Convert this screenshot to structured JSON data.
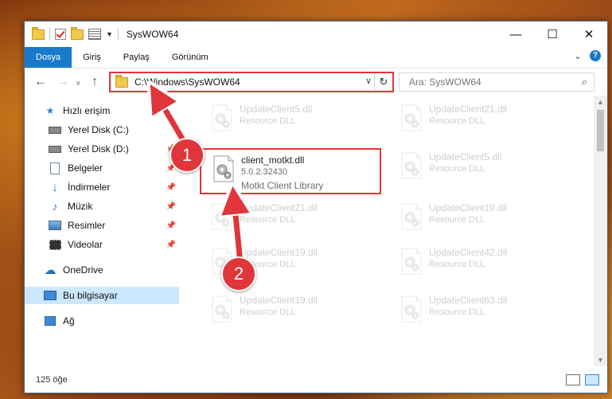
{
  "window": {
    "title": "SysWOW64",
    "controls": {
      "minimize": "—",
      "maximize": "☐",
      "close": "✕"
    }
  },
  "ribbon": {
    "tabs": [
      "Dosya",
      "Giriş",
      "Paylaş",
      "Görünüm"
    ],
    "active_tab": "Dosya",
    "expand_glyph": "⌄",
    "help_glyph": "?"
  },
  "address": {
    "path": "C:\\Windows\\SysWOW64",
    "search_placeholder": "Ara: SysWOW64"
  },
  "sidebar": {
    "items": [
      {
        "label": "Hızlı erişim",
        "icon": "star-icon",
        "pinned": false
      },
      {
        "label": "Yerel Disk (C:)",
        "icon": "drive-icon",
        "pinned": false
      },
      {
        "label": "Yerel Disk (D:)",
        "icon": "drive-icon",
        "pinned": true
      },
      {
        "label": "Belgeler",
        "icon": "document-icon",
        "pinned": true
      },
      {
        "label": "İndirmeler",
        "icon": "download-icon",
        "pinned": true
      },
      {
        "label": "Müzik",
        "icon": "music-icon",
        "pinned": true
      },
      {
        "label": "Resimler",
        "icon": "pictures-icon",
        "pinned": true
      },
      {
        "label": "Videolar",
        "icon": "video-icon",
        "pinned": true
      },
      {
        "label": "OneDrive",
        "icon": "cloud-icon",
        "pinned": false
      },
      {
        "label": "Bu bilgisayar",
        "icon": "computer-icon",
        "pinned": false,
        "selected": true
      },
      {
        "label": "Ağ",
        "icon": "network-icon",
        "pinned": false
      }
    ]
  },
  "files": {
    "focused": {
      "name": "client_motkt.dll",
      "version": "5.0.2.32430",
      "description": "Motkt Client Library"
    },
    "background": [
      {
        "name": "UpdateClient5.dll",
        "type": "Resource DLL"
      },
      {
        "name": "UpdateClient21.dll",
        "type": "Resource DLL"
      },
      {
        "name": "UpdateClient5.dll",
        "type": "Resource DLL"
      },
      {
        "name": "UpdateClient21.dll",
        "type": "Resource DLL"
      },
      {
        "name": "UpdateClient19.dll",
        "type": "Resource DLL"
      },
      {
        "name": "UpdateClient19.dll",
        "type": "Resource DLL"
      },
      {
        "name": "UpdateClient42.dll",
        "type": "Resource DLL"
      },
      {
        "name": "UpdateClient19.dll",
        "type": "Resource DLL"
      },
      {
        "name": "UpdateClient63.dll",
        "type": "Resource DLL"
      }
    ]
  },
  "status": {
    "item_count": "125 öğe"
  },
  "annotations": {
    "step1": "1",
    "step2": "2",
    "color": "#e0353a"
  }
}
